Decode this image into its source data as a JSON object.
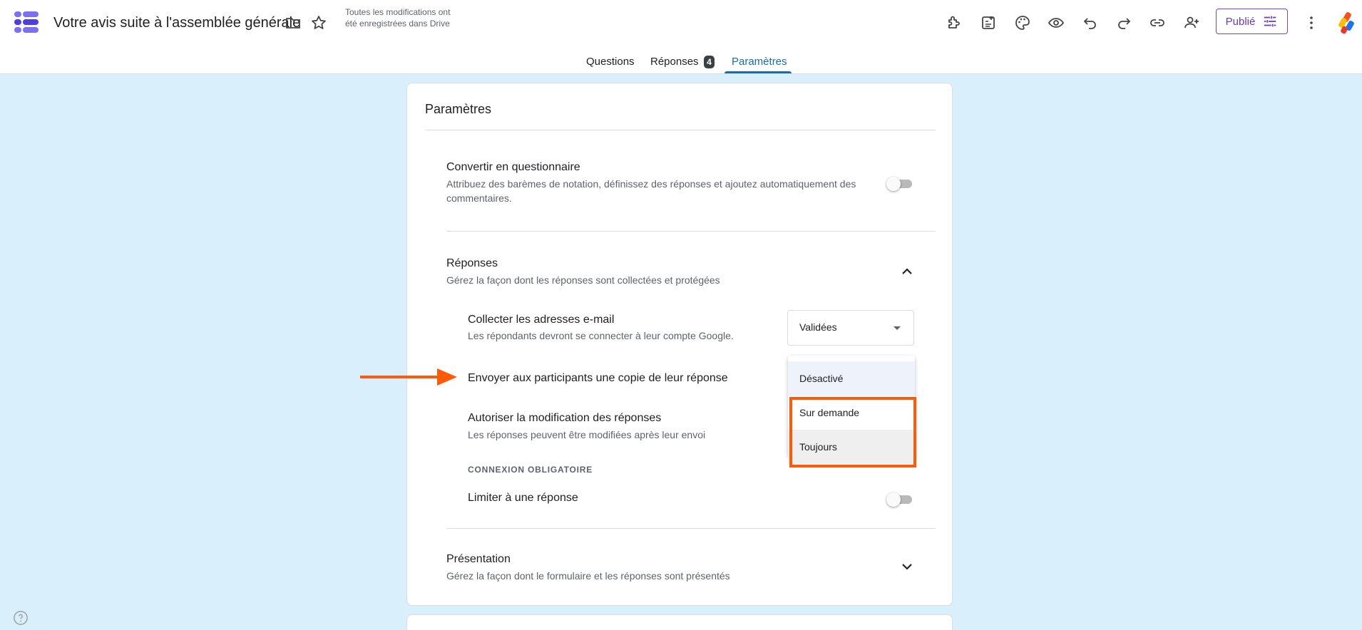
{
  "header": {
    "title": "Votre avis suite à l'assemblée générale",
    "save_status": "Toutes les modifications ont été enregistrées dans Drive",
    "publish_label": "Publié"
  },
  "tabs": [
    {
      "label": "Questions"
    },
    {
      "label": "Réponses",
      "badge": "4"
    },
    {
      "label": "Paramètres",
      "active": true
    }
  ],
  "settings": {
    "title": "Paramètres",
    "quiz": {
      "title": "Convertir en questionnaire",
      "description": "Attribuez des barèmes de notation, définissez des réponses et ajoutez automatiquement des commentaires.",
      "enabled": false
    },
    "responses": {
      "title": "Réponses",
      "description": "Gérez la façon dont les réponses sont collectées et protégées",
      "collect_email": {
        "title": "Collecter les adresses e-mail",
        "description": "Les répondants devront se connecter à leur compte Google.",
        "selected": "Validées"
      },
      "send_copy": {
        "title": "Envoyer aux participants une copie de leur réponse",
        "options": [
          "Désactivé",
          "Sur demande",
          "Toujours"
        ]
      },
      "allow_edit": {
        "title": "Autoriser la modification des réponses",
        "description": "Les réponses peuvent être modifiées après leur envoi"
      },
      "login_required_header": "CONNEXION OBLIGATOIRE",
      "limit_one": {
        "title": "Limiter à une réponse",
        "enabled": false
      }
    },
    "presentation": {
      "title": "Présentation",
      "description": "Gérez la façon dont le formulaire et les réponses sont présentés"
    }
  },
  "colors": {
    "accent": "#673ab7",
    "tab_active": "#1a6da6",
    "annotation": "#ff5a0a",
    "background": "#d9effc"
  }
}
